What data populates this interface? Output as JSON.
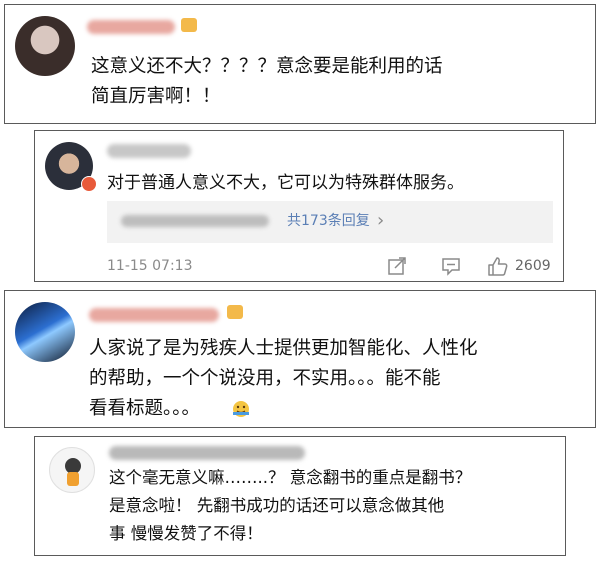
{
  "comments": [
    {
      "lines": [
        "这意义还不大？？？？意念要是能利用的话",
        "简直厉害啊！！"
      ]
    },
    {
      "lines": [
        "对于普通人意义不大，它可以为特殊群体服务。"
      ],
      "reply_summary": "共173条回复",
      "chevron": "›",
      "timestamp": "11-15 07:13",
      "like_count": "2609",
      "icons": [
        "share-icon",
        "comment-icon",
        "like-icon"
      ]
    },
    {
      "lines": [
        "人家说了是为残疾人士提供更加智能化、人性化",
        "的帮助，一个个说没用，不实用。。。能不能",
        "看看标题。。。"
      ]
    },
    {
      "lines": [
        "这个毫无意义嘛……..？ 意念翻书的重点是翻书？",
        "是意念啦！ 先翻书成功的话还可以意念做其他",
        "事 慢慢发赞了不得！"
      ]
    }
  ],
  "colors": {
    "border": "#5a5a5a",
    "reply_bg": "#f2f2f2",
    "link_blue": "#5b7fb5",
    "meta_gray": "#8a8a8a",
    "vip_gold": "#f3b94a"
  }
}
